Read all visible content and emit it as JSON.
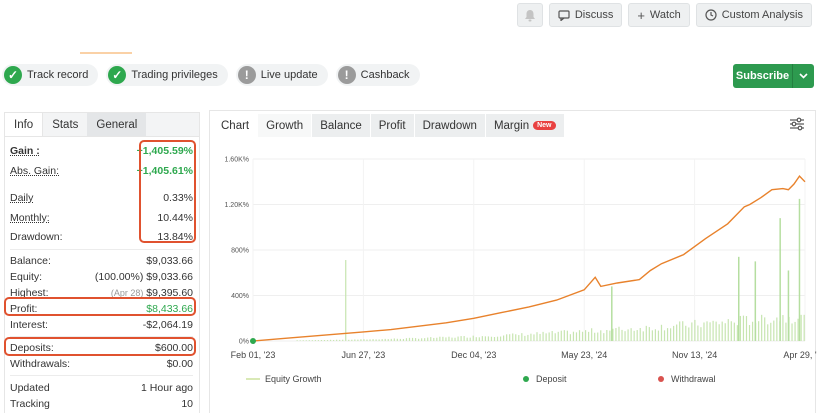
{
  "toolbar": {
    "discuss": "Discuss",
    "watch": "Watch",
    "custom_analysis": "Custom Analysis"
  },
  "badges": [
    {
      "label": "Track record",
      "status": "ok"
    },
    {
      "label": "Trading privileges",
      "status": "ok"
    },
    {
      "label": "Live update",
      "status": "warn"
    },
    {
      "label": "Cashback",
      "status": "warn"
    }
  ],
  "subscribe": {
    "label": "Subscribe"
  },
  "info": {
    "tabs": [
      "Info",
      "Stats",
      "General"
    ],
    "gain": {
      "label": "Gain :",
      "value": "+1,405.59%"
    },
    "abs_gain": {
      "label": "Abs. Gain:",
      "value": "+1,405.61%"
    },
    "daily": {
      "label": "Daily",
      "value": "0.33%"
    },
    "monthly": {
      "label": "Monthly:",
      "value": "10.44%"
    },
    "drawdown": {
      "label": "Drawdown:",
      "value": "13.84%"
    },
    "balance": {
      "label": "Balance:",
      "value": "$9,033.66"
    },
    "equity": {
      "label": "Equity:",
      "pct": "(100.00%)",
      "value": "$9,033.66"
    },
    "highest": {
      "label": "Highest:",
      "date": "(Apr 28)",
      "value": "$9,395.60"
    },
    "profit": {
      "label": "Profit:",
      "value": "$8,433.66"
    },
    "interest": {
      "label": "Interest:",
      "value": "-$2,064.19"
    },
    "deposits": {
      "label": "Deposits:",
      "value": "$600.00"
    },
    "withdrawals": {
      "label": "Withdrawals:",
      "value": "$0.00"
    },
    "updated": {
      "label": "Updated",
      "value": "1 Hour ago"
    },
    "tracking": {
      "label": "Tracking",
      "value": "10"
    }
  },
  "chart_tabs": [
    "Chart",
    "Growth",
    "Balance",
    "Profit",
    "Drawdown",
    "Margin"
  ],
  "new_badge": "New",
  "chart_data": {
    "type": "line",
    "x_ticks": [
      "Feb 01, '23",
      "Jun 27, '23",
      "Dec 04, '23",
      "May 23, '24",
      "Nov 13, '24",
      "Apr 29, '25"
    ],
    "y_ticks": [
      "0%",
      "400%",
      "800%",
      "1.20K%",
      "1.60K%"
    ],
    "ylim": [
      0,
      1600
    ],
    "series": [
      {
        "name": "Equity Growth",
        "color": "#e8822c",
        "x": [
          0,
          0.05,
          0.1,
          0.15,
          0.2,
          0.25,
          0.3,
          0.35,
          0.4,
          0.45,
          0.5,
          0.55,
          0.6,
          0.62,
          0.63,
          0.66,
          0.7,
          0.72,
          0.74,
          0.78,
          0.82,
          0.86,
          0.89,
          0.9,
          0.92,
          0.94,
          0.96,
          0.97,
          0.98,
          0.99,
          1.0
        ],
        "y": [
          0,
          20,
          40,
          60,
          80,
          100,
          130,
          160,
          200,
          250,
          300,
          360,
          450,
          560,
          480,
          510,
          540,
          620,
          680,
          760,
          900,
          1030,
          1180,
          1200,
          1260,
          1330,
          1340,
          1330,
          1380,
          1450,
          1400
        ]
      }
    ],
    "legend": [
      "Equity Growth",
      "Deposit",
      "Withdrawal"
    ],
    "legend_colors": [
      "#d9e9b6",
      "#2ea84e",
      "#d9534f"
    ]
  }
}
